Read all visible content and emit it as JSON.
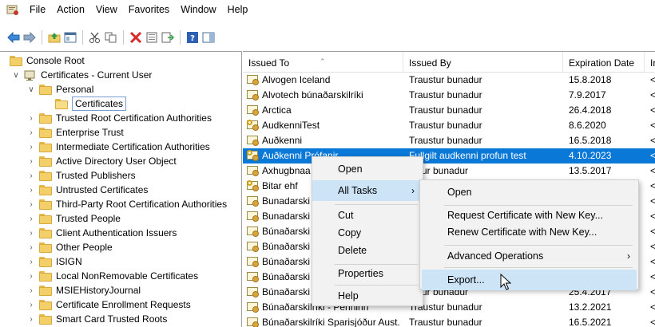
{
  "menubar": {
    "items": [
      "File",
      "Action",
      "View",
      "Favorites",
      "Window",
      "Help"
    ]
  },
  "toolbar": {
    "icons": [
      "back-arrow-icon",
      "forward-arrow-icon",
      "folder-up-icon",
      "show-hide-tree-icon",
      "cut-icon",
      "copy-icon",
      "delete-icon",
      "properties-icon",
      "export-list-icon",
      "help-icon",
      "action-pane-icon"
    ]
  },
  "tree": {
    "root": "Console Root",
    "user": "Certificates - Current User",
    "personal": "Personal",
    "certificates": "Certificates",
    "stores": [
      "Trusted Root Certification Authorities",
      "Enterprise Trust",
      "Intermediate Certification Authorities",
      "Active Directory User Object",
      "Trusted Publishers",
      "Untrusted Certificates",
      "Third-Party Root Certification Authorities",
      "Trusted People",
      "Client Authentication Issuers",
      "Other People",
      "ISIGN",
      "Local NonRemovable Certificates",
      "MSIEHistoryJournal",
      "Certificate Enrollment Requests",
      "Smart Card Trusted Roots"
    ]
  },
  "list": {
    "columns": [
      "Issued To",
      "Issued By",
      "Expiration Date",
      "Ir"
    ],
    "rows": [
      {
        "issued_to": "Alvogen Iceland",
        "issued_by": "Traustur bunadur",
        "expiration": "15.8.2018",
        "extra": "<",
        "icon": "cert"
      },
      {
        "issued_to": "Alvotech búnaðarskilríki",
        "issued_by": "Traustur bunadur",
        "expiration": "7.9.2017",
        "extra": "<",
        "icon": "cert"
      },
      {
        "issued_to": "Arctica",
        "issued_by": "Traustur bunadur",
        "expiration": "26.4.2018",
        "extra": "<",
        "icon": "cert"
      },
      {
        "issued_to": "AudkenniTest",
        "issued_by": "Traustur bunadur",
        "expiration": "8.6.2020",
        "extra": "<",
        "icon": "cert-key"
      },
      {
        "issued_to": "Auðkenni",
        "issued_by": "Traustur bunadur",
        "expiration": "16.5.2018",
        "extra": "<",
        "icon": "cert"
      },
      {
        "issued_to": "Auðkenni Prófanir",
        "issued_by": "Fullgilt audkenni profun test",
        "expiration": "4.10.2023",
        "extra": "<",
        "icon": "cert-key"
      },
      {
        "issued_to": "Axhugbnaa",
        "issued_by": "ustur bunadur",
        "expiration": "13.5.2017",
        "extra": "<",
        "icon": "cert"
      },
      {
        "issued_to": "Bitar ehf",
        "issued_by": "",
        "expiration": "",
        "extra": "<",
        "icon": "cert-key"
      },
      {
        "issued_to": "Bunadarski",
        "issued_by": "",
        "expiration": "",
        "extra": "<",
        "icon": "cert"
      },
      {
        "issued_to": "Bunadarski",
        "issued_by": "",
        "expiration": "",
        "extra": "<",
        "icon": "cert"
      },
      {
        "issued_to": "Búnaðarski",
        "issued_by": "",
        "expiration": "",
        "extra": "<",
        "icon": "cert"
      },
      {
        "issued_to": "Búnaðarski",
        "issued_by": "",
        "expiration": "",
        "extra": "<",
        "icon": "cert"
      },
      {
        "issued_to": "Búnaðarski",
        "issued_by": "",
        "expiration": "",
        "extra": "<",
        "icon": "cert"
      },
      {
        "issued_to": "Búnaðarski",
        "issued_by": "",
        "expiration": "",
        "extra": "<",
        "icon": "cert"
      },
      {
        "issued_to": "Búnaðarski",
        "issued_by": "ustur bunadur",
        "expiration": "25.4.2017",
        "extra": "<",
        "icon": "cert"
      },
      {
        "issued_to": "Búnaðarskilríki - Penninn",
        "issued_by": "Traustur bunadur",
        "expiration": "13.2.2021",
        "extra": "<",
        "icon": "cert"
      },
      {
        "issued_to": "Búnaðarskilríki Sparisjóður Aust...",
        "issued_by": "Traustur bunadur",
        "expiration": "16.5.2021",
        "extra": "<",
        "icon": "cert"
      }
    ]
  },
  "context_menu": {
    "open": "Open",
    "all_tasks": "All Tasks",
    "cut": "Cut",
    "copy": "Copy",
    "delete": "Delete",
    "properties": "Properties",
    "help": "Help"
  },
  "submenu": {
    "open": "Open",
    "request_new_key": "Request Certificate with New Key...",
    "renew_new_key": "Renew Certificate with New Key...",
    "advanced": "Advanced Operations",
    "export": "Export..."
  },
  "colors": {
    "selection": "#0a78d7",
    "menu_highlight": "#cde4f7"
  }
}
